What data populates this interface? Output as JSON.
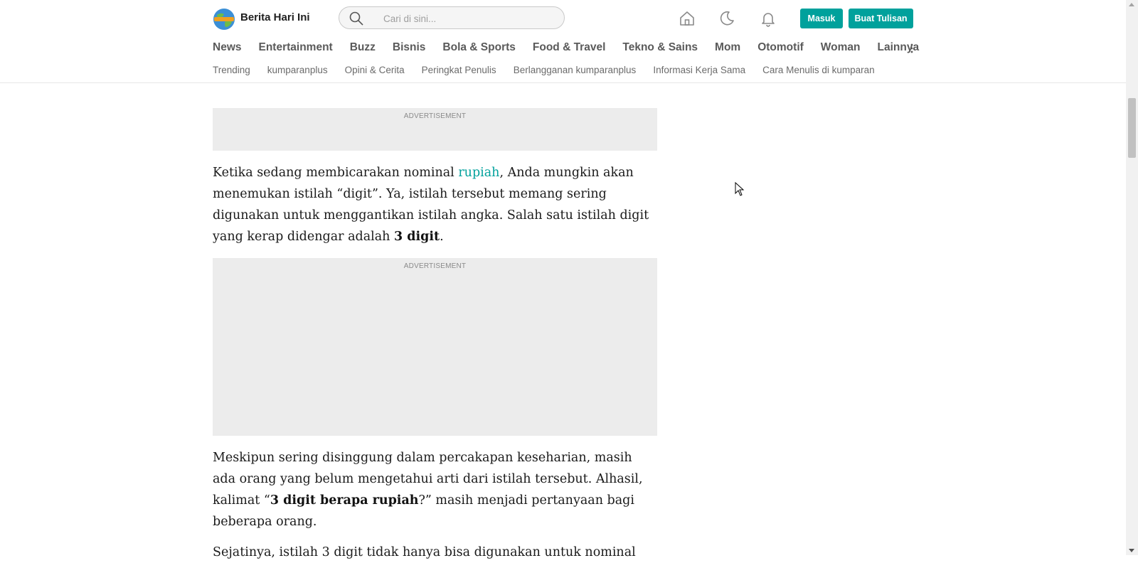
{
  "header": {
    "brand": "Berita Hari Ini",
    "search_placeholder": "Cari di sini...",
    "login_label": "Masuk",
    "write_label": "Buat Tulisan",
    "accent_color": "#00a19c"
  },
  "icons": {
    "logo": "globe-logo-icon",
    "search": "search-icon",
    "home": "home-icon",
    "dark_mode": "moon-icon",
    "notifications": "bell-icon",
    "more": "kebab-menu-icon"
  },
  "nav": {
    "items": [
      "News",
      "Entertainment",
      "Buzz",
      "Bisnis",
      "Bola & Sports",
      "Food & Travel",
      "Tekno & Sains",
      "Mom",
      "Otomotif",
      "Woman",
      "Lainnya"
    ]
  },
  "subnav": {
    "items": [
      "Trending",
      "kumparanplus",
      "Opini & Cerita",
      "Peringkat Penulis",
      "Berlangganan kumparanplus",
      "Informasi Kerja Sama",
      "Cara Menulis di kumparan"
    ]
  },
  "article": {
    "ad_label": "ADVERTISEMENT",
    "p1": {
      "before_link": "Ketika sedang membicarakan nominal ",
      "link": "rupiah",
      "after_link": ", Anda mungkin akan menemukan istilah “digit”. Ya, istilah tersebut memang sering digunakan untuk menggantikan istilah angka. Salah satu istilah digit yang kerap didengar adalah ",
      "bold": "3 digit",
      "end": "."
    },
    "p2": {
      "start": "Meskipun sering disinggung dalam percakapan keseharian, masih ada orang yang belum mengetahui arti dari istilah tersebut. Alhasil, kalimat “",
      "bold": "3 digit berapa rupiah",
      "end": "?” masih menjadi pertanyaan bagi beberapa orang."
    },
    "p3_partial": "Sejatinya, istilah 3 digit tidak hanya bisa digunakan untuk nominal"
  }
}
